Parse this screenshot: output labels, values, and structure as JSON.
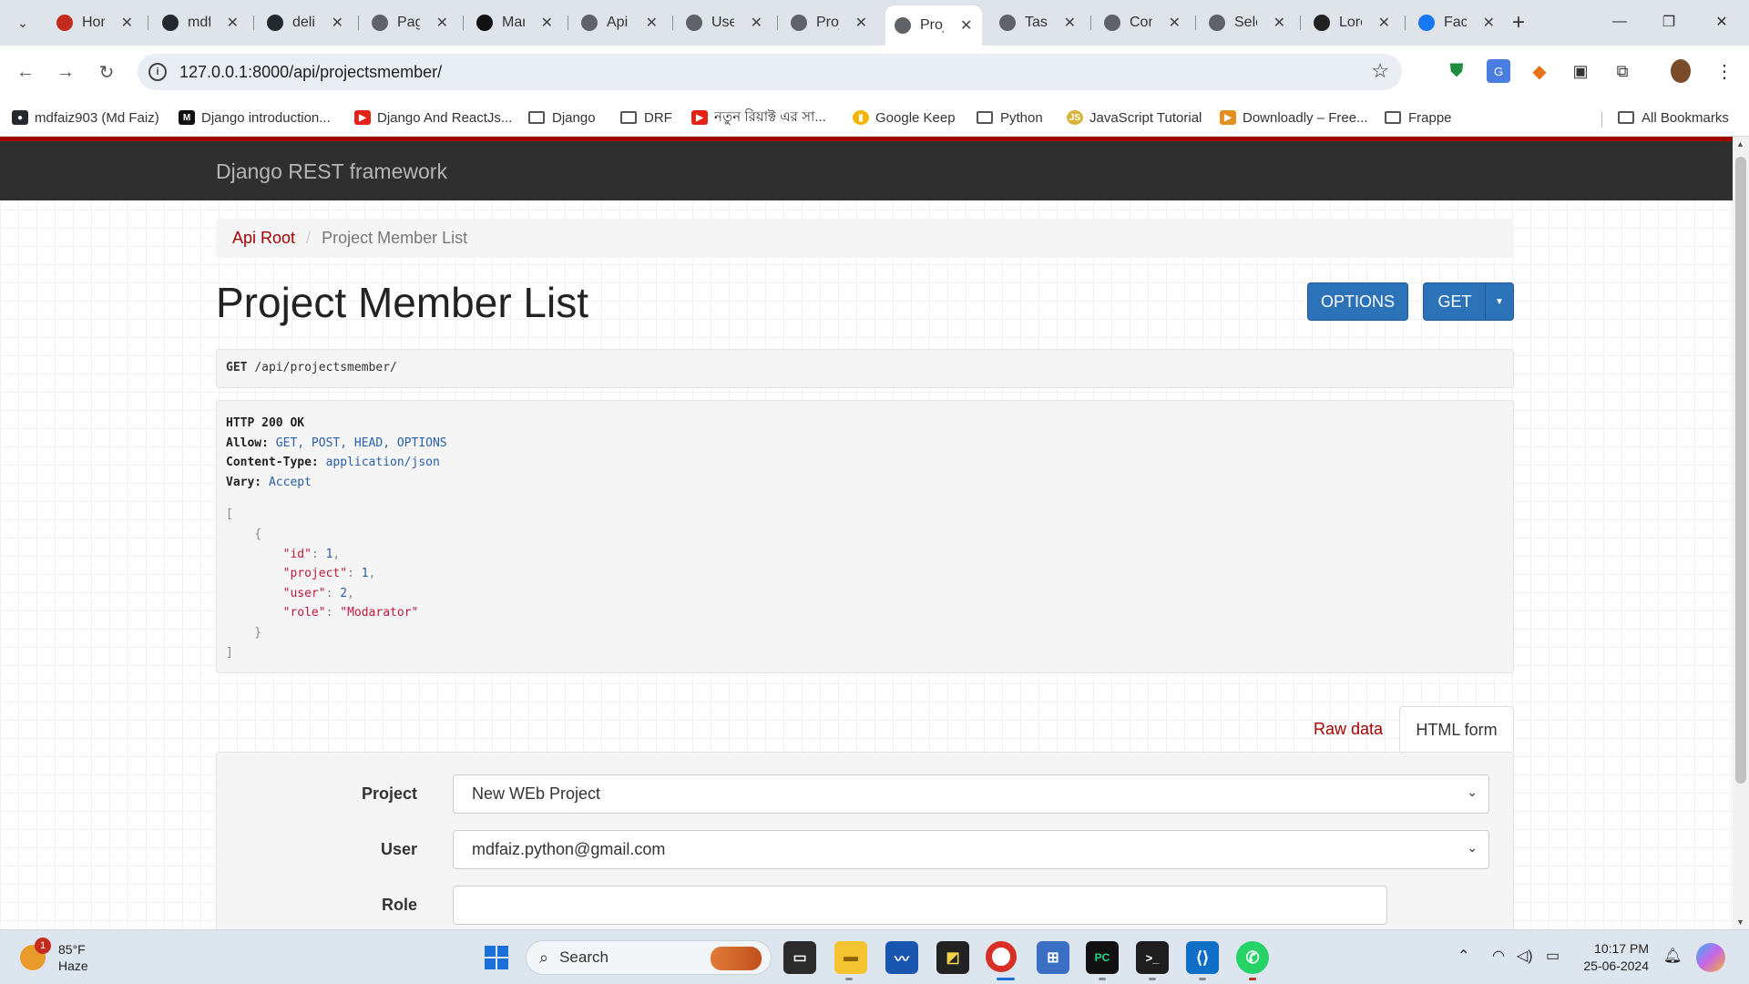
{
  "browser": {
    "tabs": [
      {
        "title": "Hon",
        "favicon": "red-pin-icon",
        "color": "#c42b1c",
        "active": false
      },
      {
        "title": "mdf",
        "favicon": "github-icon",
        "color": "#24292f",
        "active": false
      },
      {
        "title": "deli",
        "favicon": "github-icon",
        "color": "#24292f",
        "active": false
      },
      {
        "title": "Pag",
        "favicon": "globe-icon",
        "color": "#5f6368",
        "active": false
      },
      {
        "title": "Mar",
        "favicon": "mar-logo-icon",
        "color": "#111111",
        "active": false
      },
      {
        "title": "Api",
        "favicon": "globe-icon",
        "color": "#5f6368",
        "active": false
      },
      {
        "title": "Use",
        "favicon": "globe-icon",
        "color": "#5f6368",
        "active": false
      },
      {
        "title": "Proj",
        "favicon": "globe-icon",
        "color": "#5f6368",
        "active": false
      },
      {
        "title": "Proj",
        "favicon": "globe-icon",
        "color": "#5f6368",
        "active": true
      },
      {
        "title": "Task",
        "favicon": "globe-icon",
        "color": "#5f6368",
        "active": false
      },
      {
        "title": "Con",
        "favicon": "globe-icon",
        "color": "#5f6368",
        "active": false
      },
      {
        "title": "Sele",
        "favicon": "globe-icon",
        "color": "#5f6368",
        "active": false
      },
      {
        "title": "Lore",
        "favicon": "lorem-l-icon",
        "color": "#222222",
        "active": false
      },
      {
        "title": "Face",
        "favicon": "facebook-icon",
        "color": "#1877f2",
        "active": false
      }
    ],
    "url": "127.0.0.1:8000/api/projectsmember/",
    "bookmarks": [
      {
        "label": "mdfaiz903 (Md Faiz)",
        "icon": "github-icon"
      },
      {
        "label": "Django introduction...",
        "icon": "m-logo-icon"
      },
      {
        "label": "Django And ReactJs...",
        "icon": "youtube-icon"
      },
      {
        "label": "Django",
        "icon": "folder-icon"
      },
      {
        "label": "DRF",
        "icon": "folder-icon"
      },
      {
        "label": "নতুন রিয়াক্ট এর সা...",
        "icon": "youtube-icon"
      },
      {
        "label": "Google Keep",
        "icon": "keep-icon"
      },
      {
        "label": "Python",
        "icon": "folder-icon"
      },
      {
        "label": "JavaScript Tutorial",
        "icon": "js-icon"
      },
      {
        "label": "Downloadly – Free...",
        "icon": "downloadly-icon"
      },
      {
        "label": "Frappe",
        "icon": "folder-icon"
      }
    ],
    "all_bookmarks": "All Bookmarks"
  },
  "page": {
    "brand": "Django REST framework",
    "breadcrumb": {
      "root": "Api Root",
      "current": "Project Member List"
    },
    "title": "Project Member List",
    "options_button": "OPTIONS",
    "get_button": "GET",
    "request": {
      "method": "GET",
      "path": "/api/projectsmember/"
    },
    "response": {
      "status": "HTTP 200 OK",
      "headers": [
        {
          "key": "Allow:",
          "value": "GET, POST, HEAD, OPTIONS"
        },
        {
          "key": "Content-Type:",
          "value": "application/json"
        },
        {
          "key": "Vary:",
          "value": "Accept"
        }
      ],
      "body": {
        "id": "1",
        "project": "1",
        "user": "2",
        "role": "\"Modarator\""
      }
    },
    "form_tabs": {
      "raw": "Raw data",
      "html": "HTML form"
    },
    "form": {
      "project_label": "Project",
      "project_value": "New WEb Project",
      "user_label": "User",
      "user_value": "mdfaiz.python@gmail.com",
      "role_label": "Role",
      "role_value": ""
    }
  },
  "taskbar": {
    "weather": {
      "temp": "85°F",
      "condition": "Haze",
      "badge": "1"
    },
    "search": "Search",
    "time": "10:17 PM",
    "date": "25-06-2024"
  }
}
